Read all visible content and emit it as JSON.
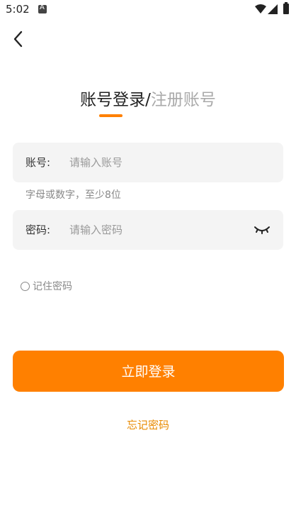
{
  "status_bar": {
    "time": "5:02",
    "icons": [
      "app-notification-icon",
      "wifi-icon",
      "signal-icon",
      "battery-icon"
    ]
  },
  "header": {
    "back_icon": "back-arrow-icon"
  },
  "title": {
    "active": "账号登录",
    "separator": "/",
    "inactive": "注册账号"
  },
  "account": {
    "label": "账号:",
    "value": "",
    "placeholder": "请输入账号",
    "hint": "字母或数字，至少8位"
  },
  "password": {
    "label": "密码:",
    "value": "",
    "placeholder": "请输入密码",
    "toggle_icon": "eye-closed-icon"
  },
  "remember": {
    "label": "记住密码",
    "checked": false
  },
  "login_button": "立即登录",
  "forgot_link": "忘记密码",
  "colors": {
    "accent": "#ff8000",
    "link": "#e88a00",
    "field_bg": "#f4f4f4"
  }
}
